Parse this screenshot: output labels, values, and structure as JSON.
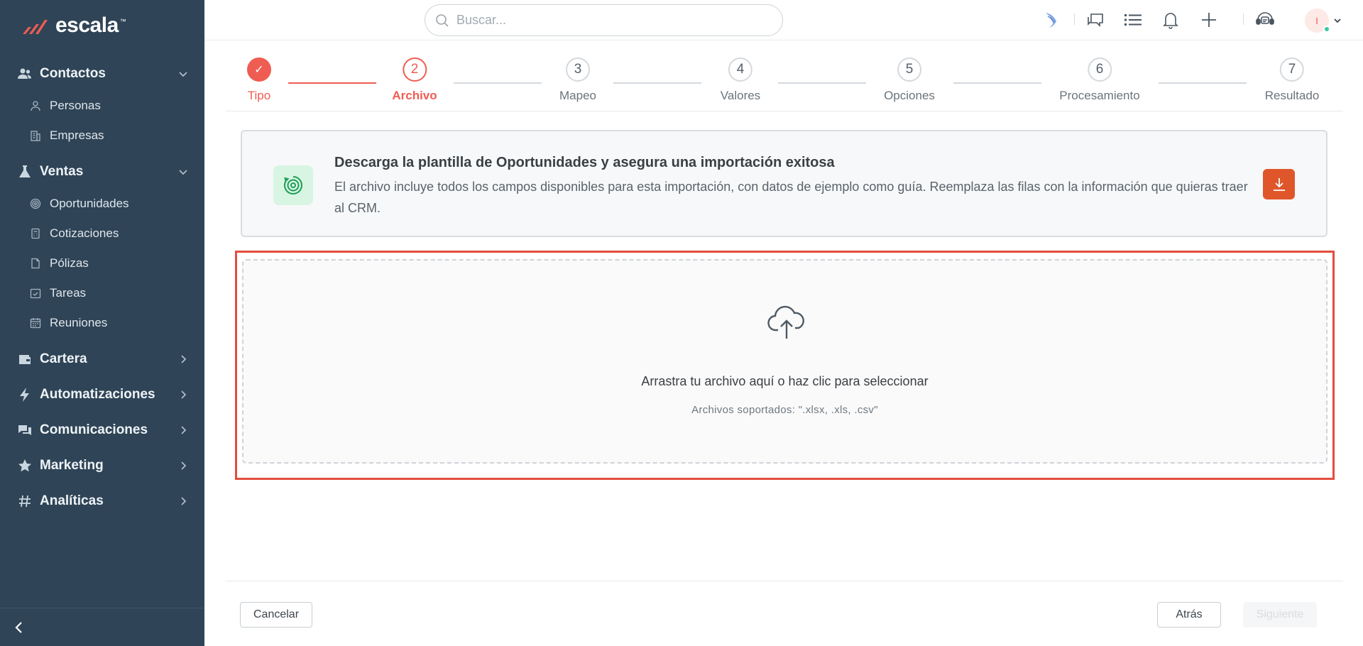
{
  "brand": {
    "name": "escala",
    "tm": "™"
  },
  "search": {
    "placeholder": "Buscar..."
  },
  "sidebar": {
    "sections": [
      {
        "label": "Contactos",
        "icon": "users-icon",
        "expanded": true,
        "items": [
          {
            "label": "Personas",
            "icon": "person-icon"
          },
          {
            "label": "Empresas",
            "icon": "building-icon"
          }
        ]
      },
      {
        "label": "Ventas",
        "icon": "flask-icon",
        "expanded": true,
        "items": [
          {
            "label": "Oportunidades",
            "icon": "target-icon"
          },
          {
            "label": "Cotizaciones",
            "icon": "calculator-icon"
          },
          {
            "label": "Pólizas",
            "icon": "file-icon"
          },
          {
            "label": "Tareas",
            "icon": "checklist-icon"
          },
          {
            "label": "Reuniones",
            "icon": "calendar-icon"
          }
        ]
      },
      {
        "label": "Cartera",
        "icon": "wallet-icon",
        "expanded": false
      },
      {
        "label": "Automatizaciones",
        "icon": "bolt-icon",
        "expanded": false
      },
      {
        "label": "Comunicaciones",
        "icon": "chat-icon",
        "expanded": false
      },
      {
        "label": "Marketing",
        "icon": "star-icon",
        "expanded": false
      },
      {
        "label": "Analíticas",
        "icon": "hash-icon",
        "expanded": false
      }
    ]
  },
  "user": {
    "initial": "I"
  },
  "stepper": {
    "steps": [
      {
        "num": "✓",
        "label": "Tipo",
        "state": "done"
      },
      {
        "num": "2",
        "label": "Archivo",
        "state": "active"
      },
      {
        "num": "3",
        "label": "Mapeo",
        "state": "pending"
      },
      {
        "num": "4",
        "label": "Valores",
        "state": "pending"
      },
      {
        "num": "5",
        "label": "Opciones",
        "state": "pending"
      },
      {
        "num": "6",
        "label": "Procesamiento",
        "state": "pending"
      },
      {
        "num": "7",
        "label": "Resultado",
        "state": "pending"
      }
    ]
  },
  "template_card": {
    "title": "Descarga la plantilla de Oportunidades y asegura una importación exitosa",
    "description": "El archivo incluye todos los campos disponibles para esta importación, con datos de ejemplo como guía. Reemplaza las filas con la información que quieras traer al CRM."
  },
  "dropzone": {
    "title": "Arrastra tu archivo aquí o haz clic para seleccionar",
    "subtitle": "Archivos soportados: \".xlsx, .xls, .csv\""
  },
  "footer": {
    "cancel": "Cancelar",
    "back": "Atrás",
    "next": "Siguiente"
  },
  "colors": {
    "sidebar": "#2f4456",
    "accent": "#ef5d52",
    "download": "#e0562b",
    "highlight": "#e44d3e"
  }
}
